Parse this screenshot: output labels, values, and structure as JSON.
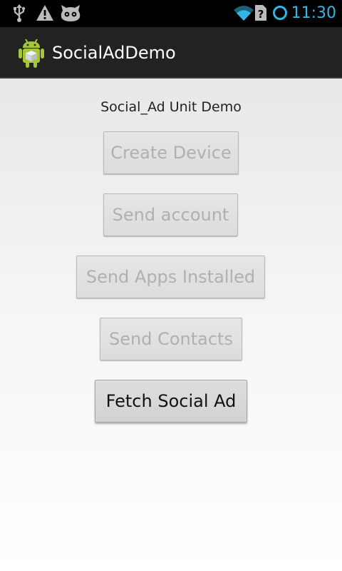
{
  "status_bar": {
    "time": "11:30",
    "icons": [
      "usb-icon",
      "warning-icon",
      "cyanogenmod-icon",
      "wifi-icon",
      "sim-unknown-icon",
      "sync-icon"
    ]
  },
  "action_bar": {
    "title": "SocialAdDemo",
    "icon": "android-app-icon"
  },
  "main": {
    "heading": "Social_Ad Unit Demo",
    "buttons": [
      {
        "label": "Create Device",
        "enabled": false
      },
      {
        "label": "Send account",
        "enabled": false
      },
      {
        "label": "Send Apps Installed",
        "enabled": false
      },
      {
        "label": "Send Contacts",
        "enabled": false
      },
      {
        "label": "Fetch Social Ad",
        "enabled": true
      }
    ]
  },
  "colors": {
    "status_time": "#33b5e5",
    "action_bar_bg": "#222222",
    "disabled_text": "#b0b0b0",
    "enabled_text": "#111111"
  }
}
